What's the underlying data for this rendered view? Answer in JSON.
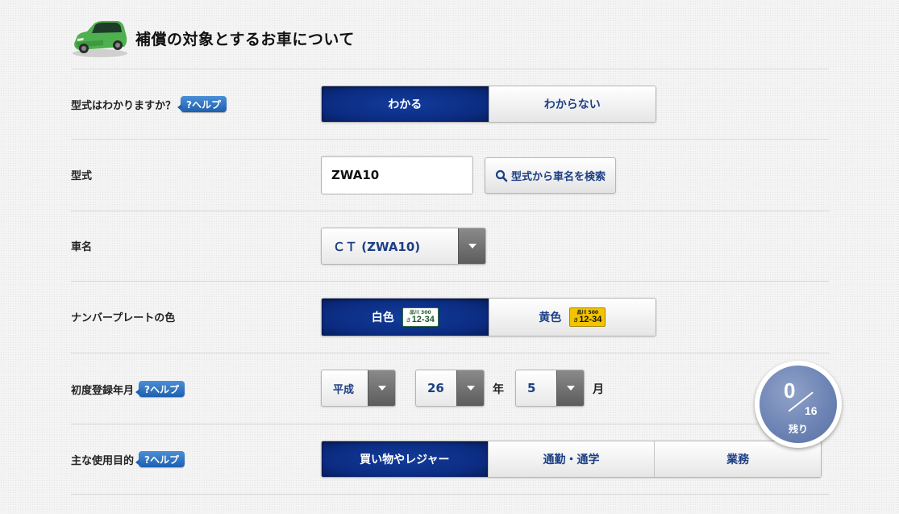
{
  "header": {
    "title": "補償の対象とするお車について",
    "icon": "car-icon"
  },
  "help_label": "?ヘルプ",
  "rows": {
    "katashiki_known": {
      "label": "型式はわかりますか？",
      "options": [
        "わかる",
        "わからない"
      ],
      "selected": "わかる"
    },
    "katashiki": {
      "label": "型式",
      "value": "ZWA10",
      "search_button": "型式から車名を検索"
    },
    "car_name": {
      "label": "車名",
      "selected": "ＣＴ (ZWA10)"
    },
    "plate_color": {
      "label": "ナンバープレートの色",
      "options": [
        "白色",
        "黄色"
      ],
      "selected": "白色",
      "plates": [
        {
          "region": "品川 300",
          "kana": "さ",
          "number": "12-34"
        },
        {
          "region": "品川 500",
          "kana": "さ",
          "number": "12-34"
        }
      ]
    },
    "first_registration": {
      "label": "初度登録年月",
      "era": "平成",
      "year": "26",
      "year_unit": "年",
      "month": "5",
      "month_unit": "月"
    },
    "usage": {
      "label": "主な使用目的",
      "options": [
        "買い物やレジャー",
        "通勤・通学",
        "業務"
      ],
      "selected": "買い物やレジャー"
    }
  },
  "progress": {
    "remaining": "0",
    "total": "16",
    "label": "残り"
  },
  "colors": {
    "active": "#0b2b80",
    "accent_text": "#1d3f84",
    "help_badge": "#2a6cc0"
  }
}
